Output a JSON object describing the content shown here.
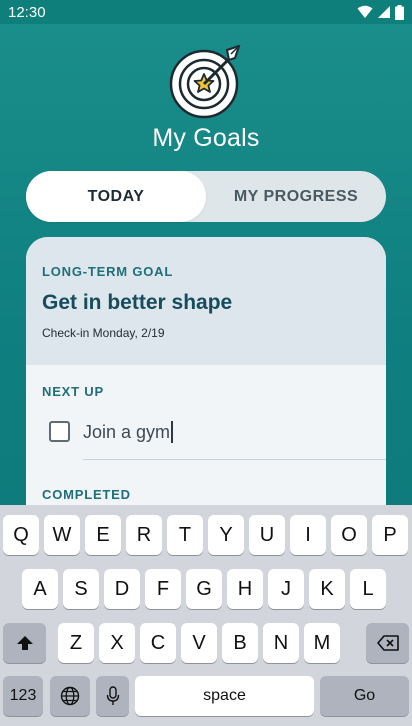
{
  "status": {
    "time": "12:30"
  },
  "header": {
    "title": "My Goals"
  },
  "tabs": [
    {
      "label": "TODAY",
      "selected": true
    },
    {
      "label": "MY PROGRESS",
      "selected": false
    }
  ],
  "card": {
    "long_term_label": "LONG-TERM GOAL",
    "goal_title": "Get in better shape",
    "checkin_text": "Check-in Monday, 2/19",
    "next_up_label": "NEXT UP",
    "task_value": "Join a gym",
    "task_checked": false,
    "completed_label": "COMPLETED"
  },
  "keyboard": {
    "row1": [
      "Q",
      "W",
      "E",
      "R",
      "T",
      "Y",
      "U",
      "I",
      "O",
      "P"
    ],
    "row2": [
      "A",
      "S",
      "D",
      "F",
      "G",
      "H",
      "J",
      "K",
      "L"
    ],
    "row3": [
      "Z",
      "X",
      "C",
      "V",
      "B",
      "N",
      "M"
    ],
    "numbers_label": "123",
    "space_label": "space",
    "go_label": "Go"
  },
  "colors": {
    "teal_background": "#0f7f80",
    "accent_text": "#1f6f78",
    "goal_title": "#174d5a"
  }
}
